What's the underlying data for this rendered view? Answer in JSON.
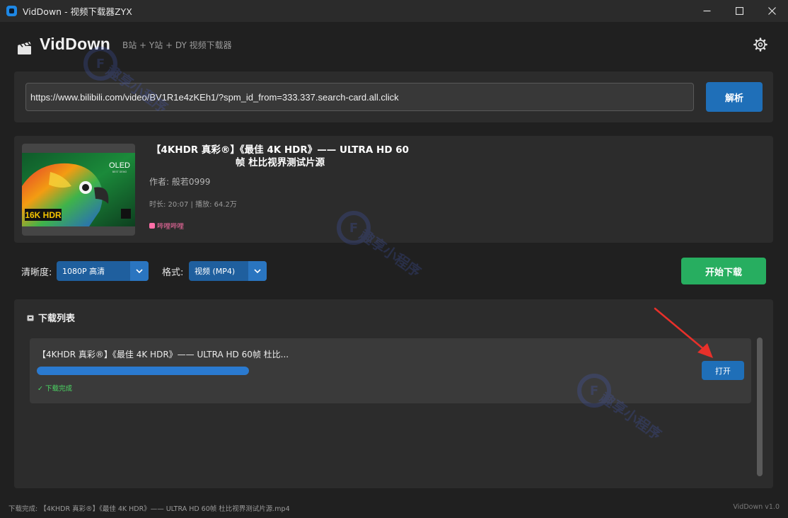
{
  "window": {
    "title": "VidDown - 视频下载器ZYX",
    "controls": {
      "minimize": "—",
      "maximize": "□",
      "close": "✕"
    }
  },
  "header": {
    "brand": "VidDown",
    "subtitle": "B站 + Y站 + DY 视频下载器",
    "settings_icon": "gear-icon",
    "logo_icon": "clapperboard-icon"
  },
  "url_bar": {
    "value": "https://www.bilibili.com/video/BV1R1e4zKEh1/?spm_id_from=333.337.search-card.all.click",
    "parse_label": "解析"
  },
  "video_info": {
    "title": "【4KHDR 真彩®】《最佳 4K HDR》—— ULTRA HD 60帧 杜比视界测试片源",
    "author": "作者: 般若0999",
    "meta": "时长: 20:07 | 播放: 64.2万",
    "platform": "哔哩哔哩",
    "thumbnail": {
      "badge_left": "16K HDR",
      "badge_right": "OLED",
      "badge_right_sub": "BEST DEMO"
    }
  },
  "options": {
    "quality_label": "清晰度:",
    "quality_value": "1080P 高清",
    "format_label": "格式:",
    "format_value": "视频 (MP4)",
    "download_label": "开始下载"
  },
  "download_list": {
    "title": "下载列表",
    "items": [
      {
        "name": "【4KHDR 真彩®】《最佳 4K HDR》—— ULTRA HD 60帧 杜比...",
        "progress": 1.0,
        "status": "✓ 下载完成",
        "open_label": "打开"
      }
    ]
  },
  "status_bar": {
    "message": "下载完成: 【4KHDR 真彩®】《最佳 4K HDR》—— ULTRA HD 60帧 杜比视界测试片源.mp4",
    "version": "VidDown v1.0"
  },
  "watermark_text": "趣享小程序",
  "colors": {
    "accent_blue": "#1f6fb8",
    "success_green": "#27ae60",
    "status_green": "#4cd964",
    "tag_pink": "#ff6fa8",
    "annotation_red": "#e8302a"
  }
}
